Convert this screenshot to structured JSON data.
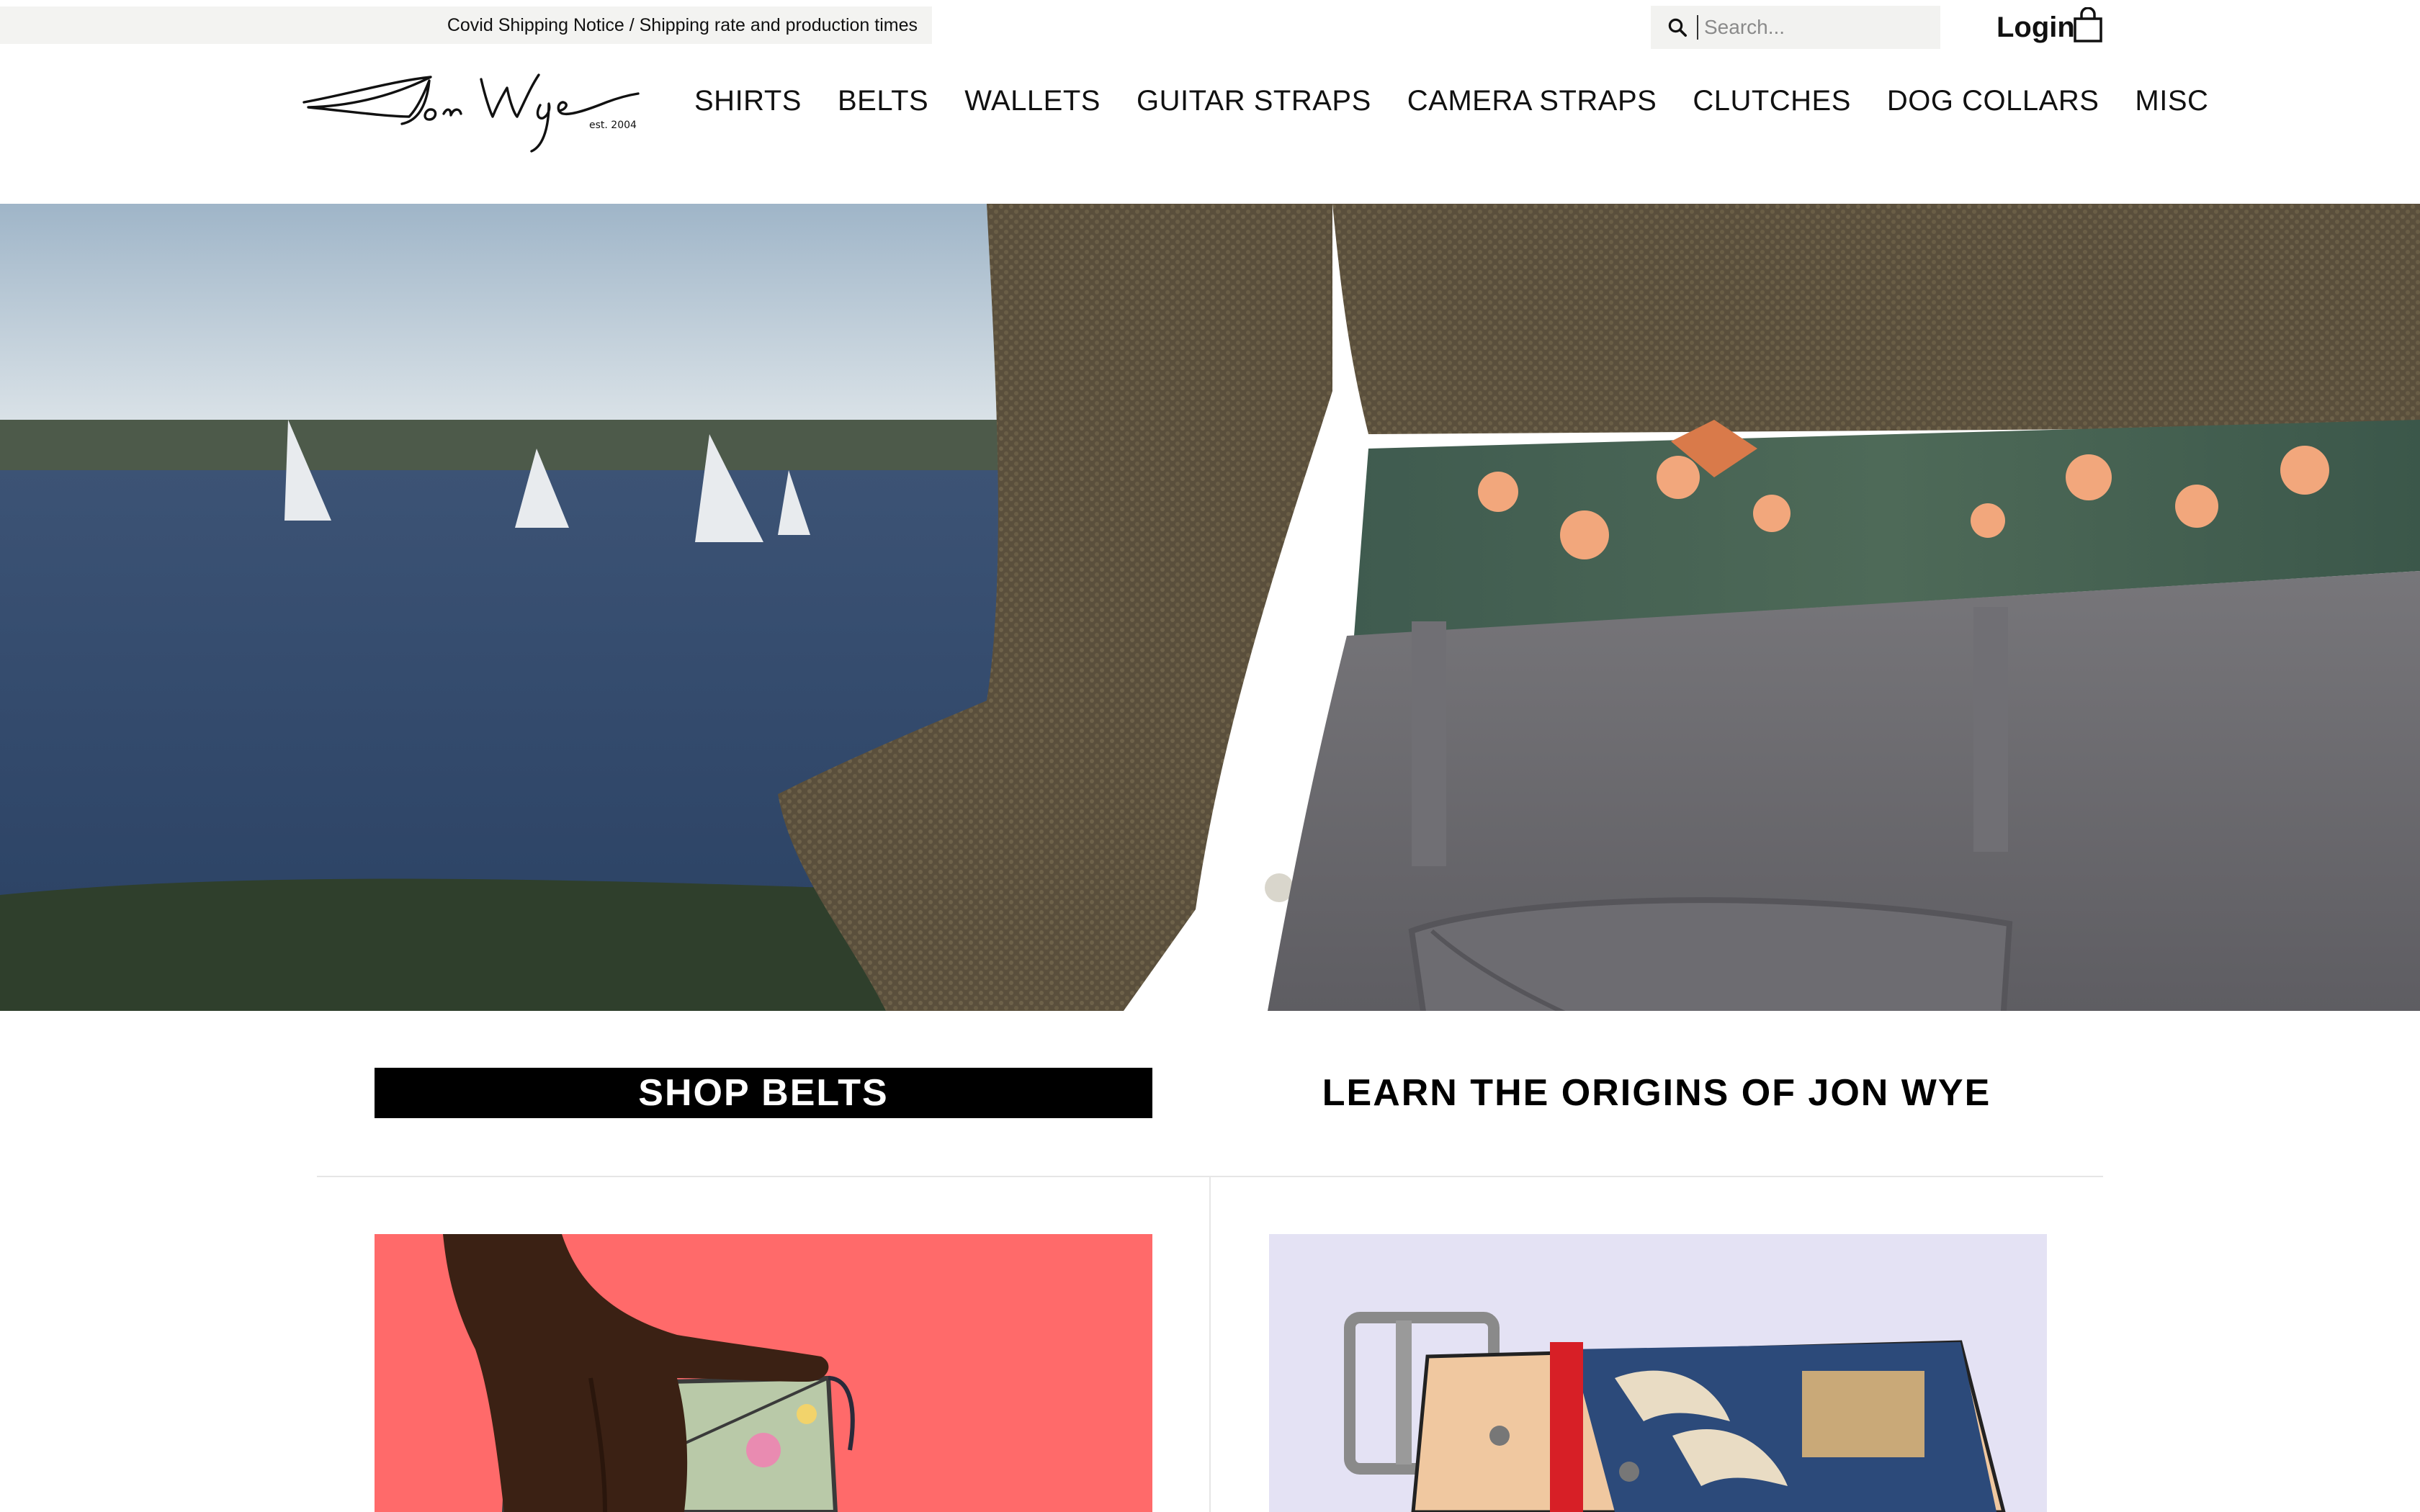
{
  "topbar": {
    "notice": "Covid Shipping Notice / Shipping rate and production times",
    "search_placeholder": "Search...",
    "login_label": "Login",
    "search_icon": "search-icon",
    "cart_icon": "shopping-bag-icon"
  },
  "brand": {
    "logo_text": "Jon Wye",
    "logo_subtext": "est. 2004"
  },
  "nav": {
    "items": [
      {
        "label": "SHIRTS"
      },
      {
        "label": "BELTS"
      },
      {
        "label": "WALLETS"
      },
      {
        "label": "GUITAR STRAPS"
      },
      {
        "label": "CAMERA STRAPS"
      },
      {
        "label": "CLUTCHES"
      },
      {
        "label": "DOG COLLARS"
      },
      {
        "label": "MISC"
      }
    ]
  },
  "cta": {
    "shop_label": "SHOP BELTS",
    "learn_label": "LEARN THE ORIGINS OF JON WYE"
  },
  "colors": {
    "accent": "#000000",
    "tile_left_bg": "#ff6a6a",
    "tile_right_bg": "#e4e2f4",
    "notice_bg": "#f3f3f1"
  }
}
